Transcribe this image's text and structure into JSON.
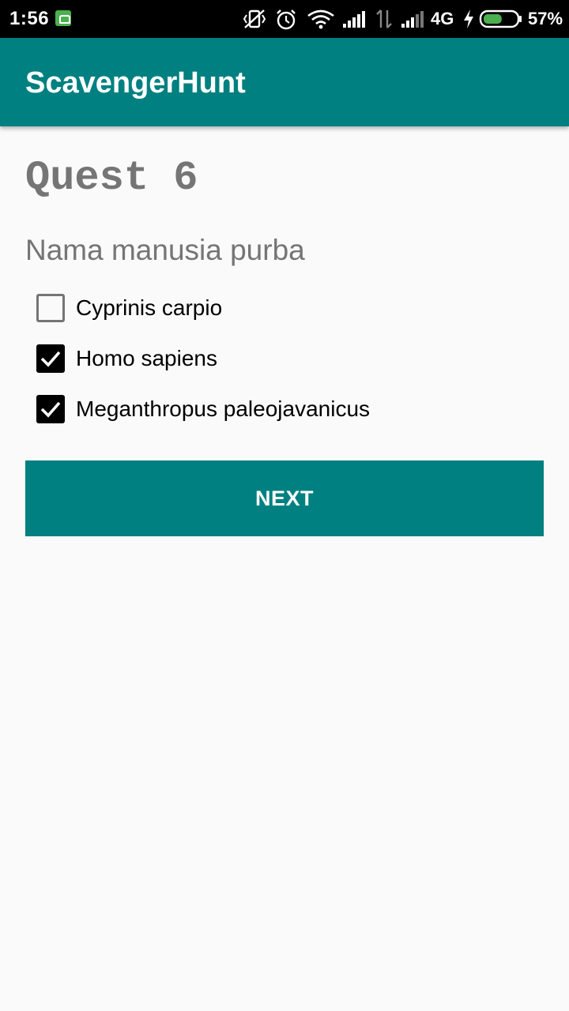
{
  "status_bar": {
    "time": "1:56",
    "network": "4G",
    "battery": "57%",
    "battery_level": 0.57
  },
  "app": {
    "title": "ScavengerHunt",
    "accent_color": "#008080"
  },
  "quest": {
    "title": "Quest 6",
    "question": "Nama manusia purba",
    "options": [
      {
        "label": "Cyprinis carpio",
        "checked": false
      },
      {
        "label": "Homo sapiens",
        "checked": true
      },
      {
        "label": "Meganthropus paleojavanicus",
        "checked": true
      }
    ]
  },
  "actions": {
    "next_label": "NEXT"
  }
}
